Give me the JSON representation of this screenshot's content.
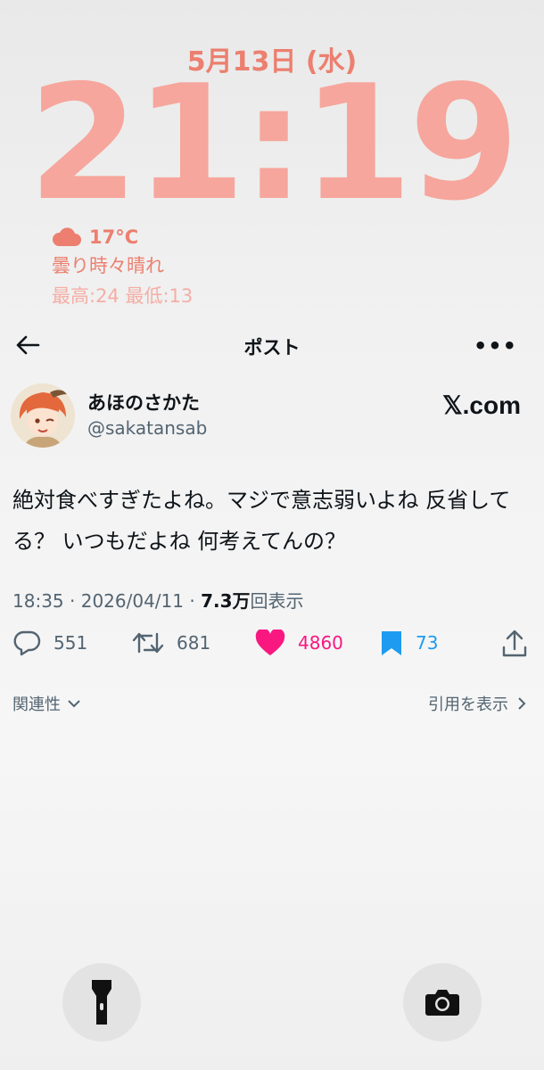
{
  "lockscreen": {
    "date": "5月13日 (水)",
    "time": "21:19",
    "weather": {
      "icon": "cloud-icon",
      "temp": "17°C",
      "condition": "曇り時々晴れ",
      "hilo": "最高:24 最低:13"
    },
    "colors": {
      "date": "#ec7f6f",
      "time": "#f6a69c"
    }
  },
  "post": {
    "header": {
      "title": "ポスト"
    },
    "author": {
      "name": "あほのさかた",
      "handle": "@sakatansab"
    },
    "source": "𝕏.com",
    "text": "絶対食べすぎたよね。マジで意志弱いよね 反省してる？ いつもだよね 何考えてんの？",
    "meta": {
      "time": "18:35",
      "date": "2026/04/11",
      "views": "7.3万",
      "views_label": "回表示"
    },
    "stats": {
      "replies": "551",
      "reposts": "681",
      "likes": "4860",
      "bookmarks": "73"
    },
    "relevance_label": "関連性",
    "quotes_label": "引用を表示",
    "colors": {
      "like": "#f91880",
      "bookmark": "#1d9bf0"
    }
  },
  "quick_actions": [
    "flashlight-icon",
    "camera-icon"
  ]
}
